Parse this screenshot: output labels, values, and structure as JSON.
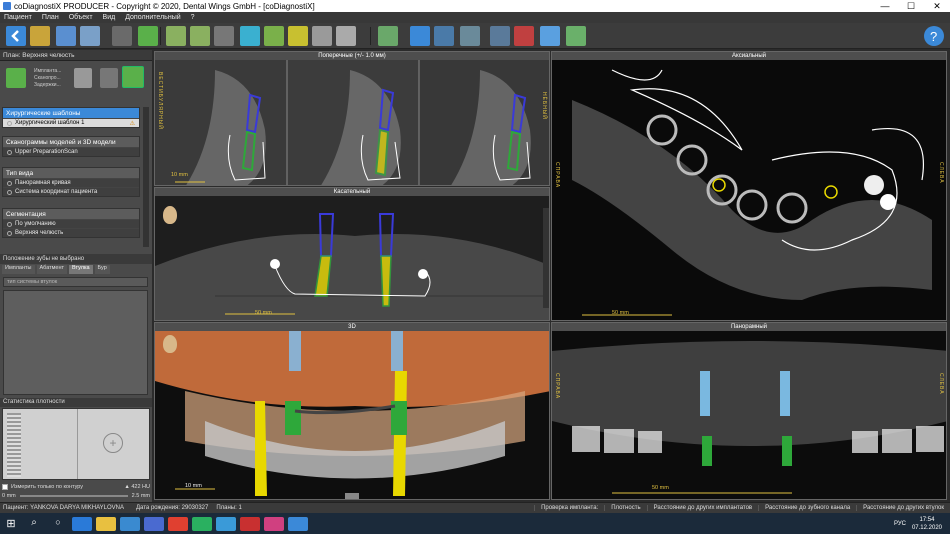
{
  "window": {
    "title": "coDiagnostiX PRODUCER - Copyright © 2020, Dental Wings GmbH - [coDiagnostiX]"
  },
  "menu": [
    "Пациент",
    "План",
    "Объект",
    "Вид",
    "Дополнительный",
    "?"
  ],
  "left_panel": {
    "header": "План: Верхняя челюсть",
    "mini_list": [
      "Импланта...",
      "Сканопро...",
      "Задержки..."
    ],
    "sections": [
      {
        "title": "Хирургические шаблоны",
        "rows": [
          "Хирургический шаблон 1"
        ]
      },
      {
        "title": "Сканограммы моделей и 3D модели",
        "rows": [
          "Upper PreparationScan"
        ]
      },
      {
        "title": "Тип вида",
        "rows": [
          "Панорамная кривая",
          "Система координат пациента"
        ]
      },
      {
        "title": "Сегментация",
        "rows": [
          "По умолчанию",
          "Верхняя челюсть"
        ]
      }
    ],
    "library_header": "Положение зубы не выбрано",
    "library_tabs": [
      "Импланты",
      "Абатмент",
      "Втулка",
      "Бур"
    ],
    "library_search": "тип системы втулок",
    "density_header": "Статистика плотности",
    "measure_checkbox": "Измерить только по контуру",
    "density_value": "▲ 422 HU",
    "length_value": "2.5 mm",
    "length_start": "0 mm"
  },
  "viewports": {
    "cross": {
      "title": "Поперечные (+/- 1.0 мм)",
      "left_label": "ВЕСТИБУЛЯРНЫЙ",
      "right_label": "НЁБНЫЙ",
      "scale": "10 mm"
    },
    "tangential": {
      "title": "Касательный",
      "scale": "50 mm"
    },
    "axial": {
      "title": "Аксиальный",
      "left_label": "СПРАВА",
      "right_label": "СЛЕВА",
      "scale": "50 mm"
    },
    "view3d": {
      "title": "3D",
      "scale": "10 mm"
    },
    "panoramic": {
      "title": "Панорамный",
      "left_label": "СПРАВА",
      "right_label": "СЛЕВА",
      "scale": "50 mm"
    }
  },
  "status": {
    "patient": "Пациент: YANKOVA DARYA MIKHAYLOVNA",
    "birth": "Дата рождения: 29030327",
    "plans": "Планы: 1",
    "right": [
      "Проверка импланта:",
      "Плотность",
      "Расстояние до других имплантатов",
      "Расстояние до зубного канала",
      "Расстояние до других втулок"
    ]
  },
  "taskbar": {
    "lang": "РУС",
    "time": "17:54",
    "date": "07.12.2020"
  },
  "colors": {
    "accent": "#3b89d8",
    "implant_blue": "#3a3ad8",
    "implant_green": "#2ea83a",
    "sleeve_yellow": "#e8d800"
  }
}
